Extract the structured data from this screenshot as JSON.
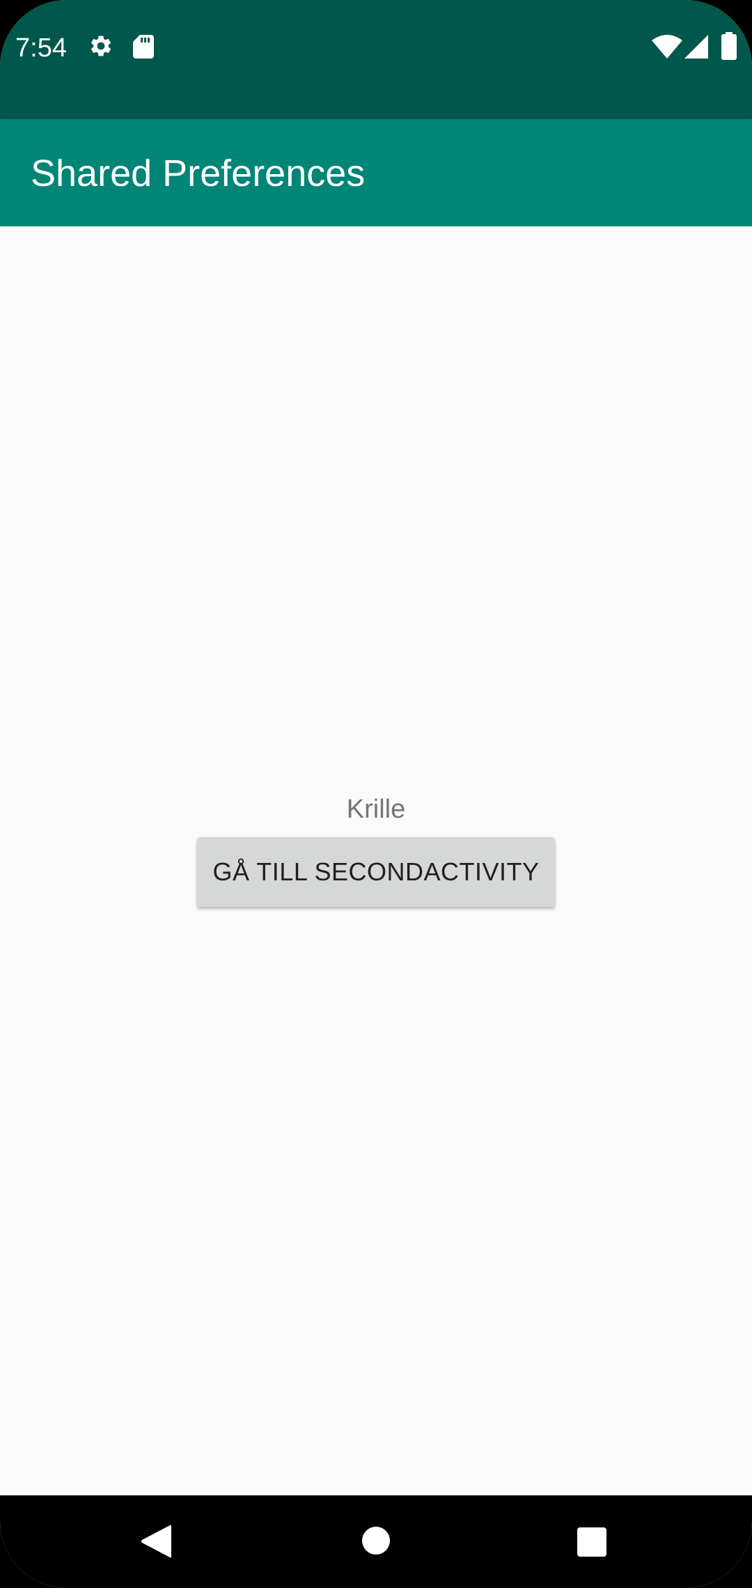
{
  "status_bar": {
    "time": "7:54",
    "left_icons": [
      "gear-icon",
      "sd-card-icon"
    ],
    "right_icons": [
      "wifi-icon",
      "signal-icon",
      "battery-icon"
    ]
  },
  "app_bar": {
    "title": "Shared Preferences"
  },
  "main": {
    "name_text": "Krille",
    "button_label": "GÅ TILL SECONDACTIVITY"
  },
  "nav_bar": {
    "buttons": [
      "back-icon",
      "home-icon",
      "recents-icon"
    ]
  },
  "colors": {
    "status_bar": "#00574b",
    "app_bar": "#008577",
    "background": "#fafafa",
    "button": "#d6d7d7"
  }
}
